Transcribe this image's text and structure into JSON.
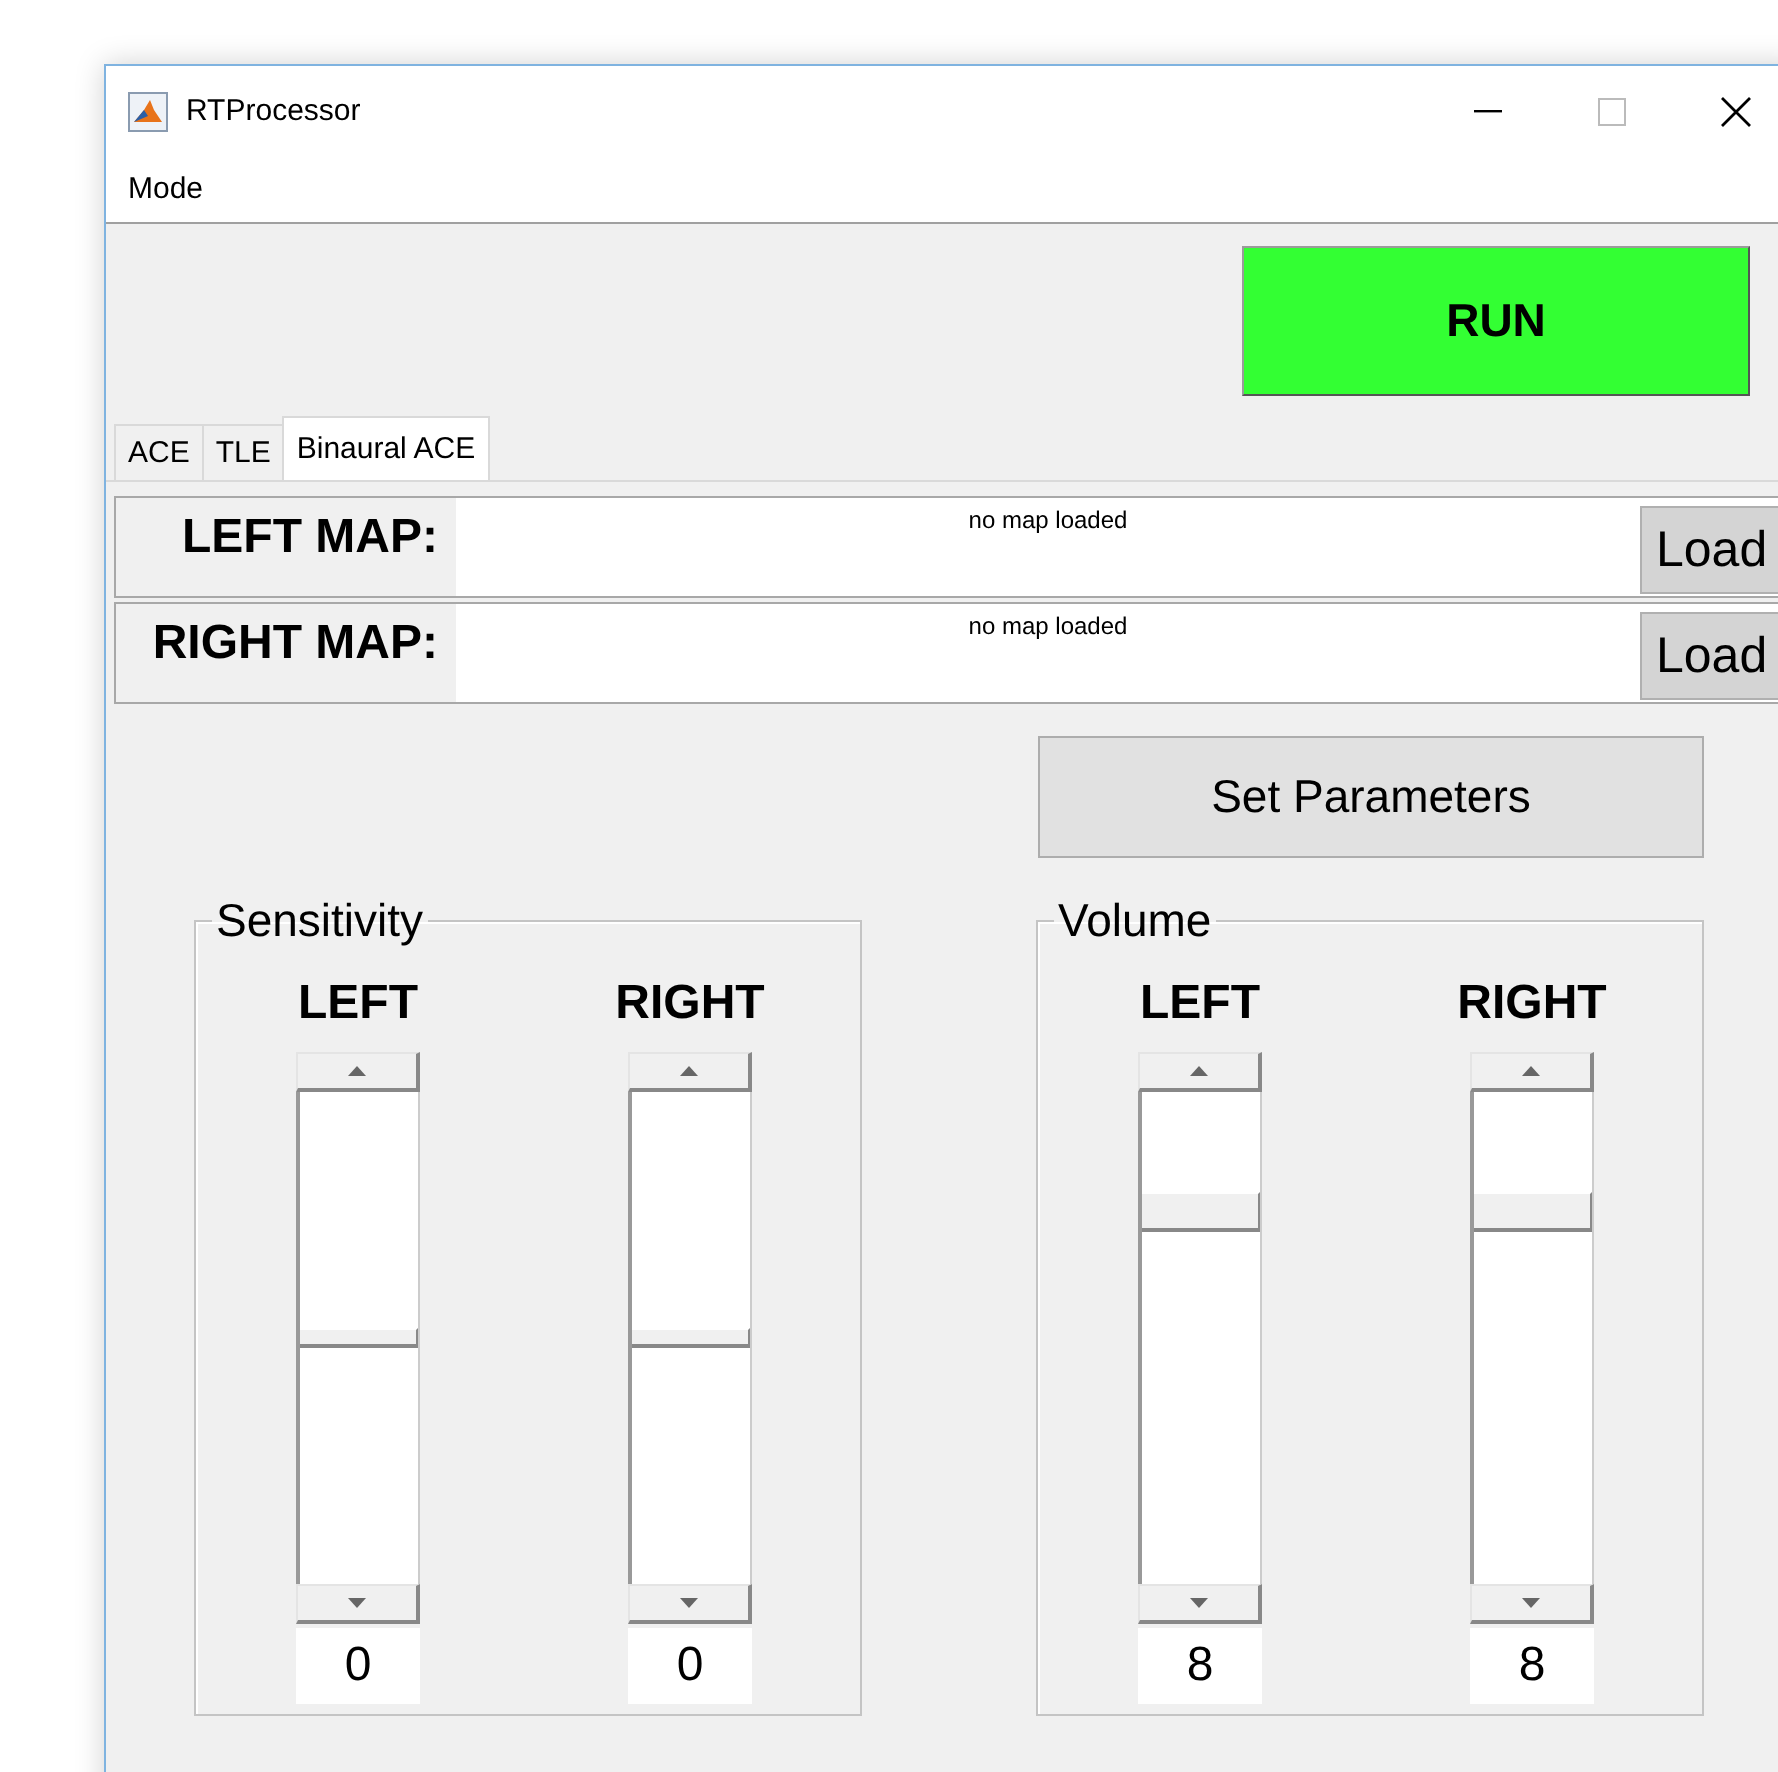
{
  "window": {
    "title": "RTProcessor"
  },
  "menu": [
    "Mode"
  ],
  "run_button": "RUN",
  "tabs": [
    {
      "label": "ACE",
      "selected": false
    },
    {
      "label": "TLE",
      "selected": false
    },
    {
      "label": "Binaural ACE",
      "selected": true
    }
  ],
  "maps": [
    {
      "label": "LEFT MAP:",
      "status": "no map loaded",
      "button": "Load"
    },
    {
      "label": "RIGHT MAP:",
      "status": "no map loaded",
      "button": "Load"
    }
  ],
  "set_parameters_button": "Set Parameters",
  "groups": [
    {
      "title": "Sensitivity",
      "channels": [
        {
          "label": "LEFT",
          "level": 0.5,
          "value": "0"
        },
        {
          "label": "RIGHT",
          "level": 0.5,
          "value": "0"
        }
      ]
    },
    {
      "title": "Volume",
      "channels": [
        {
          "label": "LEFT",
          "level": 0.78,
          "value": "8"
        },
        {
          "label": "RIGHT",
          "level": 0.78,
          "value": "8"
        }
      ]
    }
  ]
}
